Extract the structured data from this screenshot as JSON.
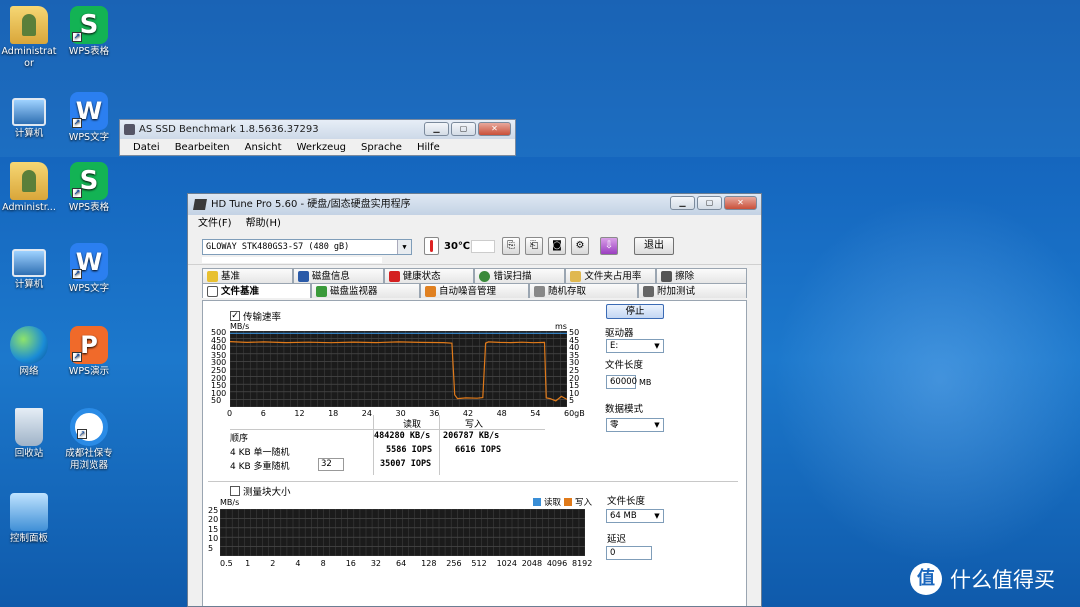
{
  "desktop": {
    "icons": [
      {
        "label": "Administrat\nor",
        "type": "folder"
      },
      {
        "label": "WPS表格",
        "type": "wps-s"
      },
      {
        "label": "计算机",
        "type": "pc"
      },
      {
        "label": "WPS文字",
        "type": "wps-w"
      },
      {
        "label": "Administr...",
        "type": "folder"
      },
      {
        "label": "WPS表格",
        "type": "wps-s"
      },
      {
        "label": "计算机",
        "type": "pc"
      },
      {
        "label": "WPS文字",
        "type": "wps-w"
      },
      {
        "label": "网络",
        "type": "net"
      },
      {
        "label": "WPS演示",
        "type": "wps-p"
      },
      {
        "label": "回收站",
        "type": "bin"
      },
      {
        "label": "成都社保专用浏览器",
        "type": "browser"
      },
      {
        "label": "控制面板",
        "type": "cpanel"
      }
    ]
  },
  "asssd": {
    "title": "AS SSD Benchmark 1.8.5636.37293",
    "menu": [
      "Datei",
      "Bearbeiten",
      "Ansicht",
      "Werkzeug",
      "Sprache",
      "Hilfe"
    ]
  },
  "hdtune": {
    "title": "HD Tune Pro 5.60 - 硬盘/固态硬盘实用程序",
    "menu": [
      "文件(F)",
      "帮助(H)"
    ],
    "drive": "GLOWAY STK480GS3-S7 (480 gB)",
    "temperature": "30℃",
    "exit_label": "退出",
    "tabs_row1": [
      "基准",
      "磁盘信息",
      "健康状态",
      "错误扫描",
      "文件夹占用率",
      "擦除"
    ],
    "tabs_row2": [
      "文件基准",
      "磁盘监视器",
      "自动噪音管理",
      "随机存取",
      "附加测试"
    ],
    "active_tab": "文件基准",
    "transfer_rate_label": "传输速率",
    "block_size_label": "测量块大小",
    "y_unit_left": "MB/s",
    "y_unit_right": "ms",
    "results": {
      "col_read": "读取",
      "col_write": "写入",
      "rows": [
        {
          "label": "顺序",
          "read": "484280 KB/s",
          "write": "206787 KB/s"
        },
        {
          "label": "4 KB 单一随机",
          "read": "5586 IOPS",
          "write": "6616 IOPS"
        },
        {
          "label": "4 KB 多重随机",
          "read": "35007 IOPS",
          "write": "",
          "queue": "32"
        }
      ]
    },
    "side": {
      "stop_label": "停止",
      "drive_label": "驱动器",
      "drive_value": "E:",
      "file_length_label": "文件长度",
      "file_length_value": "60000",
      "file_length_unit": "MB",
      "data_mode_label": "数据模式",
      "data_mode_value": "零",
      "file_length2_label": "文件长度",
      "file_length2_value": "64 MB",
      "delay_label": "延迟",
      "delay_value": "0"
    },
    "legend": {
      "read": "读取",
      "write": "写入"
    }
  },
  "chart_data": [
    {
      "type": "line",
      "title": "",
      "xlabel": "",
      "ylabel": "MB/s",
      "x_ticks": [
        "0",
        "6",
        "12",
        "18",
        "24",
        "30",
        "36",
        "42",
        "48",
        "54",
        "60gB"
      ],
      "y_ticks_left": [
        "500",
        "450",
        "400",
        "350",
        "300",
        "250",
        "200",
        "150",
        "100",
        "50"
      ],
      "y_ticks_right": [
        "50",
        "45",
        "40",
        "35",
        "30",
        "25",
        "20",
        "15",
        "10",
        "5"
      ],
      "xlim": [
        0,
        60
      ],
      "ylim": [
        0,
        500
      ],
      "grid": true,
      "series": [
        {
          "color": "#e07a1a",
          "x": [
            0,
            3,
            6,
            10,
            14,
            18,
            22,
            26,
            30,
            34,
            38,
            39.5,
            40,
            40.5,
            42,
            44,
            45,
            45.5,
            46,
            48,
            50,
            52,
            54,
            56,
            56.3,
            57,
            58,
            59,
            60
          ],
          "values": [
            430,
            425,
            428,
            424,
            426,
            423,
            427,
            424,
            428,
            425,
            424,
            420,
            80,
            55,
            60,
            58,
            62,
            420,
            428,
            425,
            424,
            426,
            423,
            425,
            60,
            55,
            40,
            70,
            50
          ]
        },
        {
          "color": "#3a8ed6",
          "x": [
            0,
            60
          ],
          "values": [
            485,
            485
          ]
        }
      ]
    },
    {
      "type": "bar",
      "title": "",
      "ylabel": "MB/s",
      "categories": [
        "0.5",
        "1",
        "2",
        "4",
        "8",
        "16",
        "32",
        "64",
        "128",
        "256",
        "512",
        "1024",
        "2048",
        "4096",
        "8192"
      ],
      "y_ticks": [
        "25",
        "20",
        "15",
        "10",
        "5"
      ],
      "ylim": [
        0,
        25
      ],
      "series": [
        {
          "name": "读取",
          "color": "#3a8ed6",
          "values": []
        },
        {
          "name": "写入",
          "color": "#e07a1a",
          "values": []
        }
      ]
    }
  ],
  "watermark": "什么值得买"
}
